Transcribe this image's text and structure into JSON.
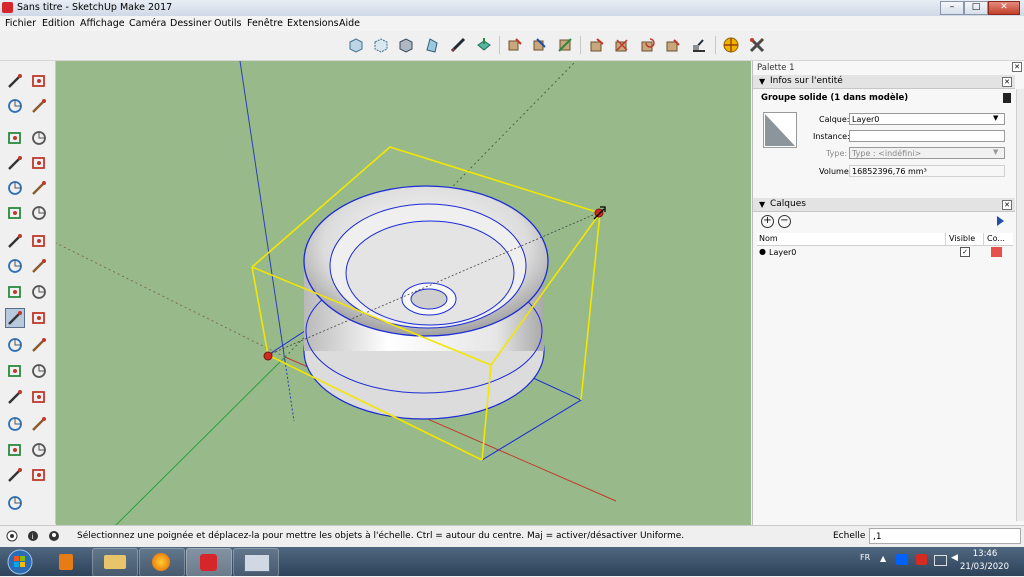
{
  "window": {
    "title": "Sans titre - SketchUp Make 2017",
    "controls": [
      "–",
      "□",
      "✕"
    ]
  },
  "menu": [
    "Fichier",
    "Edition",
    "Affichage",
    "Caméra",
    "Dessiner",
    "Outils",
    "Fenêtre",
    "Extensions",
    "Aide"
  ],
  "toolbar": {
    "icons": [
      "xray-icon",
      "back-edges-icon",
      "wireframe-icon",
      "hidden-line-icon",
      "shaded-icon",
      "textured-icon",
      "solid-union-icon",
      "solid-subtract-icon",
      "solid-trim-icon",
      "solid-intersect-icon",
      "solid-split-icon",
      "outer-shell-icon",
      "solid-tools-icon",
      "warehouse-icon",
      "extension-warehouse-icon",
      "geo-location-icon",
      "extension-manager-icon"
    ]
  },
  "left_tools": [
    "select-icon",
    "component-icon",
    "paint-bucket-icon",
    "eraser-icon",
    "line-icon",
    "freehand-icon",
    "rectangle-icon",
    "rotated-rectangle-icon",
    "circle-icon",
    "polygon-icon",
    "arc-icon",
    "pie-icon",
    "two-point-arc-icon",
    "three-point-arc-icon",
    "move-icon",
    "push-pull-icon",
    "rotate-icon",
    "follow-me-icon",
    "scale-icon",
    "offset-icon",
    "tape-measure-icon",
    "dimension-icon",
    "protractor-icon",
    "text-icon",
    "axes-icon",
    "3d-text-icon",
    "orbit-icon",
    "pan-icon",
    "zoom-icon",
    "zoom-window-icon",
    "zoom-extents-icon",
    "previous-view-icon",
    "position-camera-icon"
  ],
  "palette": {
    "title": "Palette 1",
    "entity_info": {
      "header": "Infos sur l'entité",
      "selection": "Groupe solide (1 dans modèle)",
      "calque_label": "Calque:",
      "calque_value": "Layer0",
      "instance_label": "Instance:",
      "instance_value": "",
      "type_label": "Type:",
      "type_value": "Type : <indéfini>",
      "volume_label": "Volume:",
      "volume_value": "16852396,76 mm³"
    },
    "layers": {
      "header": "Calques",
      "col_name": "Nom",
      "col_visible": "Visible",
      "col_color": "Co...",
      "rows": [
        {
          "name": "Layer0",
          "visible": true,
          "color": "#e8504e"
        }
      ]
    }
  },
  "status": {
    "message": "Sélectionnez une poignée et déplacez-la pour mettre les objets à l'échelle. Ctrl = autour du centre. Maj = activer/désactiver Uniforme.",
    "measure_label": "Echelle",
    "measure_value": ",1"
  },
  "taskbar": {
    "language": "FR",
    "time": "13:46",
    "date": "21/03/2020",
    "apps": [
      "media-player-icon",
      "file-explorer-icon",
      "firefox-icon",
      "sketchup-icon",
      "window-icon"
    ]
  },
  "colors": {
    "viewport": "#98ba8b",
    "selection": "#f3e600",
    "edges": "#1b2bd6",
    "handle": "#d22a1e"
  }
}
